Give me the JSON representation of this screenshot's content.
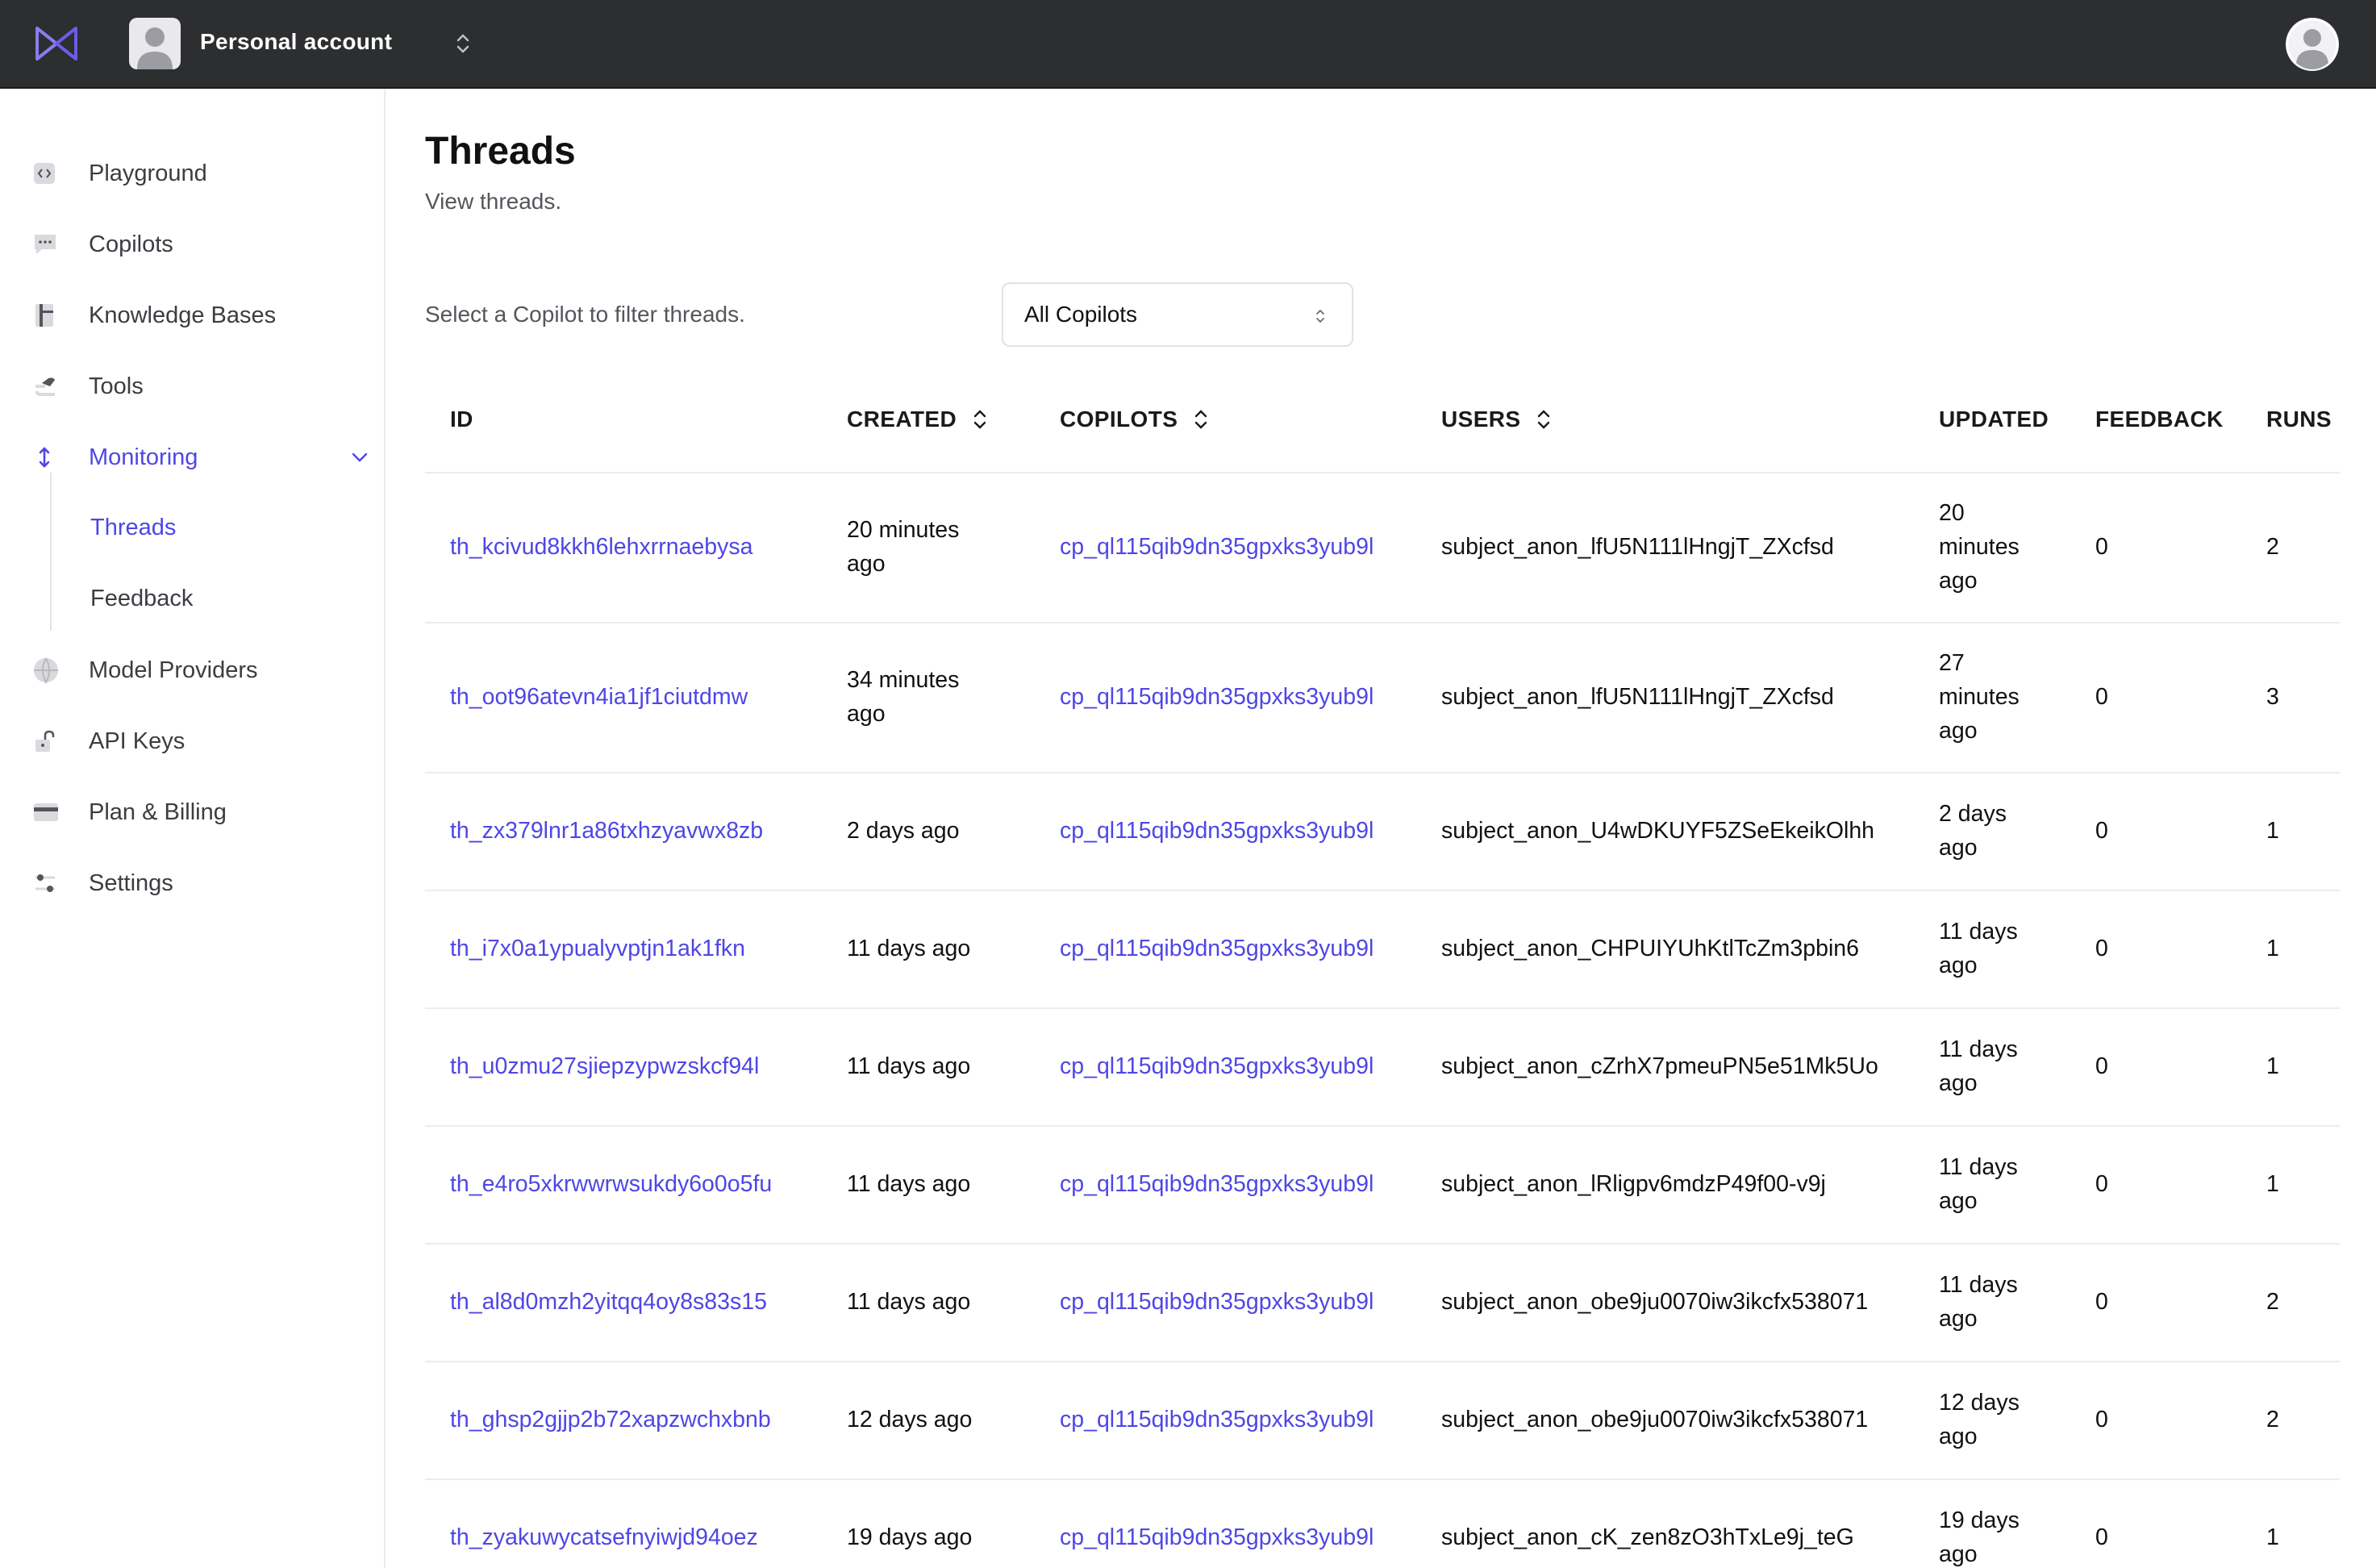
{
  "topbar": {
    "account_name": "Personal account"
  },
  "sidebar": {
    "items": [
      {
        "label": "Playground",
        "icon": "code-icon"
      },
      {
        "label": "Copilots",
        "icon": "chat-bubble-icon"
      },
      {
        "label": "Knowledge Bases",
        "icon": "book-icon"
      },
      {
        "label": "Tools",
        "icon": "tools-icon"
      },
      {
        "label": "Monitoring",
        "icon": "monitoring-icon"
      },
      {
        "label": "Model Providers",
        "icon": "globe-icon"
      },
      {
        "label": "API Keys",
        "icon": "lock-icon"
      },
      {
        "label": "Plan & Billing",
        "icon": "credit-card-icon"
      },
      {
        "label": "Settings",
        "icon": "sliders-icon"
      }
    ],
    "monitoring_children": [
      {
        "label": "Threads"
      },
      {
        "label": "Feedback"
      }
    ]
  },
  "main": {
    "title": "Threads",
    "subtitle": "View threads.",
    "filter_label": "Select a Copilot to filter threads.",
    "filter_value": "All Copilots"
  },
  "accent_color": "#4f46e5",
  "table": {
    "columns": [
      "ID",
      "CREATED",
      "COPILOTS",
      "USERS",
      "UPDATED",
      "FEEDBACK",
      "RUNS"
    ],
    "rows": [
      {
        "id": "th_kcivud8kkh6lehxrrnaebysa",
        "created": [
          "20 minutes",
          "ago"
        ],
        "copilot": "cp_ql115qib9dn35gpxks3yub9l",
        "user": "subject_anon_lfU5N111lHngjT_ZXcfsd",
        "updated": [
          "20",
          "minutes",
          "ago"
        ],
        "feedback": "0",
        "runs": "2"
      },
      {
        "id": "th_oot96atevn4ia1jf1ciutdmw",
        "created": [
          "34 minutes",
          "ago"
        ],
        "copilot": "cp_ql115qib9dn35gpxks3yub9l",
        "user": "subject_anon_lfU5N111lHngjT_ZXcfsd",
        "updated": [
          "27",
          "minutes",
          "ago"
        ],
        "feedback": "0",
        "runs": "3"
      },
      {
        "id": "th_zx379lnr1a86txhzyavwx8zb",
        "created": [
          "2 days ago"
        ],
        "copilot": "cp_ql115qib9dn35gpxks3yub9l",
        "user": "subject_anon_U4wDKUYF5ZSeEkeikOlhh",
        "updated": [
          "2 days",
          "ago"
        ],
        "feedback": "0",
        "runs": "1"
      },
      {
        "id": "th_i7x0a1ypualyvptjn1ak1fkn",
        "created": [
          "11 days ago"
        ],
        "copilot": "cp_ql115qib9dn35gpxks3yub9l",
        "user": "subject_anon_CHPUIYUhKtlTcZm3pbin6",
        "updated": [
          "11 days",
          "ago"
        ],
        "feedback": "0",
        "runs": "1"
      },
      {
        "id": "th_u0zmu27sjiepzypwzskcf94l",
        "created": [
          "11 days ago"
        ],
        "copilot": "cp_ql115qib9dn35gpxks3yub9l",
        "user": "subject_anon_cZrhX7pmeuPN5e51Mk5Uo",
        "updated": [
          "11 days",
          "ago"
        ],
        "feedback": "0",
        "runs": "1"
      },
      {
        "id": "th_e4ro5xkrwwrwsukdy6o0o5fu",
        "created": [
          "11 days ago"
        ],
        "copilot": "cp_ql115qib9dn35gpxks3yub9l",
        "user": "subject_anon_lRligpv6mdzP49f00-v9j",
        "updated": [
          "11 days",
          "ago"
        ],
        "feedback": "0",
        "runs": "1"
      },
      {
        "id": "th_al8d0mzh2yitqq4oy8s83s15",
        "created": [
          "11 days ago"
        ],
        "copilot": "cp_ql115qib9dn35gpxks3yub9l",
        "user": "subject_anon_obe9ju0070iw3ikcfx538071",
        "updated": [
          "11 days",
          "ago"
        ],
        "feedback": "0",
        "runs": "2"
      },
      {
        "id": "th_ghsp2gjjp2b72xapzwchxbnb",
        "created": [
          "12 days ago"
        ],
        "copilot": "cp_ql115qib9dn35gpxks3yub9l",
        "user": "subject_anon_obe9ju0070iw3ikcfx538071",
        "updated": [
          "12 days",
          "ago"
        ],
        "feedback": "0",
        "runs": "2"
      },
      {
        "id": "th_zyakuwycatsefnyiwjd94oez",
        "created": [
          "19 days ago"
        ],
        "copilot": "cp_ql115qib9dn35gpxks3yub9l",
        "user": "subject_anon_cK_zen8zO3hTxLe9j_teG",
        "updated": [
          "19 days",
          "ago"
        ],
        "feedback": "0",
        "runs": "1"
      }
    ]
  }
}
